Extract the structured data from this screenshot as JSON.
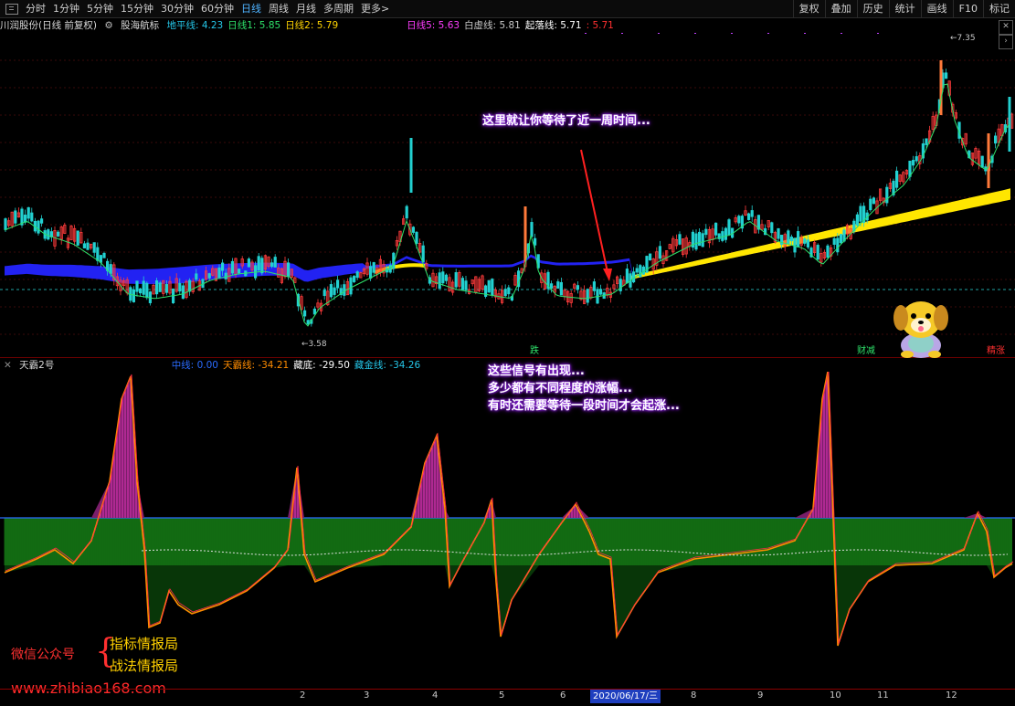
{
  "toolbar": {
    "periods": [
      "分时",
      "1分钟",
      "5分钟",
      "15分钟",
      "30分钟",
      "60分钟",
      "日线",
      "周线",
      "月线",
      "多周期",
      "更多>"
    ],
    "active_period": "日线",
    "right_buttons": [
      "复权",
      "叠加",
      "历史",
      "统计",
      "画线",
      "F10",
      "标记"
    ]
  },
  "main_legend": {
    "stock": "川润股份(日线 前复权)",
    "indicator": "股海航标",
    "items": [
      {
        "label": "地平线: 4.23",
        "color": "#25c6e8"
      },
      {
        "label": "日线1: 5.85",
        "color": "#2ee06a"
      },
      {
        "label": "日线2: 5.79",
        "color": "#ffd400"
      },
      {
        "label": "日线5: 5.63",
        "color": "#ff3dff"
      },
      {
        "label": "白虚线: 5.81",
        "color": "#c8c8c8"
      },
      {
        "label": "起落线: 5.71",
        "color": "#ffffff"
      },
      {
        "label": ": 5.71",
        "color": "#ff3030"
      }
    ]
  },
  "sub_legend": {
    "name": "天霸2号",
    "items": [
      {
        "label": "中线: 0.00",
        "color": "#2a6bff"
      },
      {
        "label": "天霸线: -34.21",
        "color": "#ff8c00"
      },
      {
        "label": "藏底: -29.50",
        "color": "#ffffff"
      },
      {
        "label": "藏金线: -34.26",
        "color": "#25c6e8"
      }
    ]
  },
  "price_labels": {
    "high": "7.35",
    "low": "3.58"
  },
  "signals": [
    {
      "text": "跌",
      "color": "#2ee06a"
    },
    {
      "text": "财减",
      "color": "#2ee06a"
    },
    {
      "text": "精涨",
      "color": "#ff3030"
    }
  ],
  "annotations": {
    "top": "这里就让你等待了近一周时间...",
    "bottom": [
      "这些信号有出现...",
      "多少都有不同程度的涨幅...",
      "有时还需要等待一段时间才会起涨..."
    ]
  },
  "watermark": {
    "label": "微信公众号",
    "line1": "指标情报局",
    "line2": "战法情报局",
    "url": "www.zhibiao168.com"
  },
  "date_axis": {
    "highlight": "2020/06/17/三",
    "ticks": [
      "2",
      "3",
      "4",
      "5",
      "6",
      "8",
      "9",
      "10",
      "11",
      "12"
    ]
  },
  "colors": {
    "up": "#ff3b3b",
    "down": "#22d0d0",
    "ma_blue": "#1e1ee8",
    "ma_yellow": "#ffe600",
    "osc_red": "#ff2a6a",
    "osc_green": "#1a8a1a",
    "osc_line": "#ff8c00"
  }
}
